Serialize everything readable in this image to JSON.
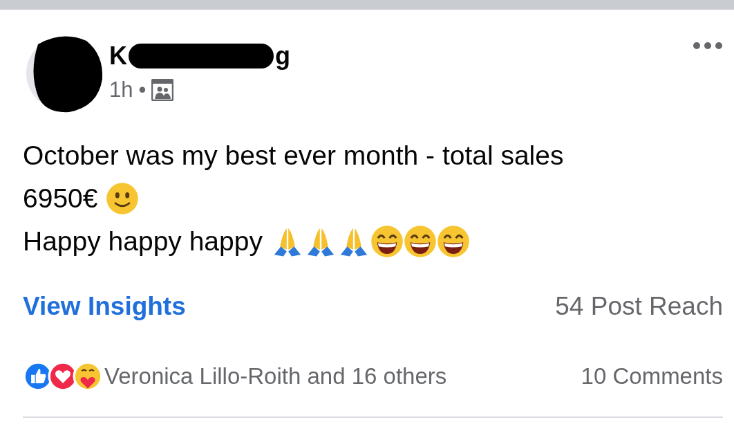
{
  "post": {
    "author": {
      "visible_start": "K",
      "visible_end": "g"
    },
    "time": "1h",
    "separator": "•",
    "lines": [
      {
        "text": "October was my best ever month - total sales"
      },
      {
        "text": "6950€",
        "emojis": [
          {
            "kind": "smile"
          }
        ]
      },
      {
        "text": "Happy happy happy",
        "emojis": [
          {
            "kind": "pray"
          },
          {
            "kind": "pray"
          },
          {
            "kind": "pray"
          },
          {
            "kind": "grin"
          },
          {
            "kind": "grin"
          },
          {
            "kind": "grin"
          }
        ]
      }
    ],
    "insights_link": "View Insights",
    "reach": "54 Post Reach",
    "reactions": [
      {
        "kind": "like"
      },
      {
        "kind": "love"
      },
      {
        "kind": "care"
      }
    ],
    "reactors": "Veronica Lillo-Roith and 16 others",
    "comments": "10 Comments"
  }
}
